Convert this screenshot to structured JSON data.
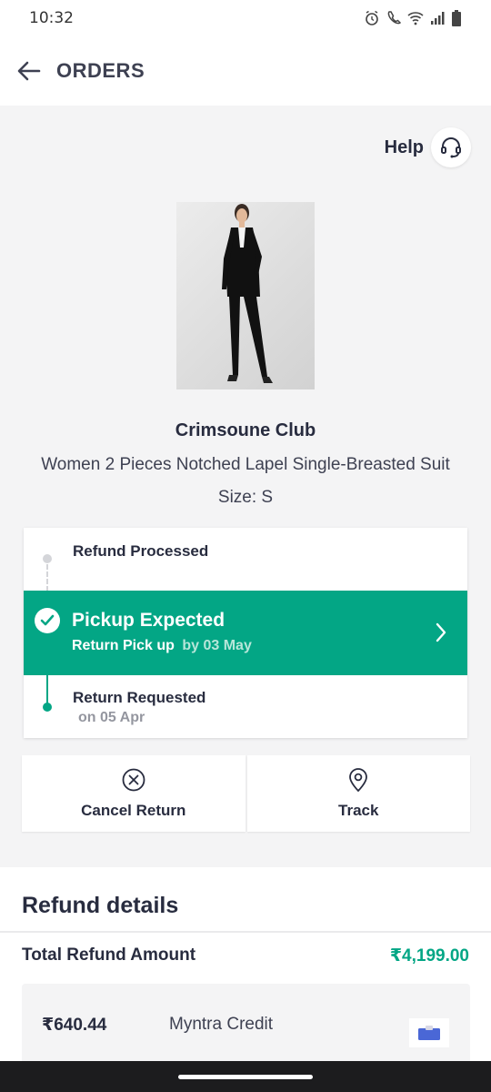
{
  "status_bar": {
    "time": "10:32",
    "icons": [
      "alarm-icon",
      "wifi-calling-icon",
      "wifi-icon",
      "signal-icon",
      "battery-icon"
    ]
  },
  "header": {
    "title": "ORDERS",
    "back_icon": "arrow-left-icon"
  },
  "help": {
    "label": "Help",
    "icon": "headset-icon"
  },
  "product": {
    "brand": "Crimsoune Club",
    "name": "Women 2 Pieces Notched Lapel Single-Breasted Suit",
    "size": "Size: S"
  },
  "tracker": {
    "steps": [
      {
        "label": "Refund Processed",
        "state": "pending"
      },
      {
        "label": "Pickup Expected",
        "sub_label": "Return Pick up",
        "sub_date": "by 03 May",
        "state": "active"
      },
      {
        "label": "Return Requested",
        "date": "on 05 Apr",
        "state": "done"
      }
    ],
    "active_color": "#03a685"
  },
  "actions": [
    {
      "label": "Cancel Return",
      "icon": "close-circle-icon"
    },
    {
      "label": "Track",
      "icon": "location-pin-icon"
    }
  ],
  "refund": {
    "heading": "Refund details",
    "total_label": "Total Refund Amount",
    "total_value": "₹4,199.00",
    "credits": [
      {
        "amount": "₹640.44",
        "method": "Myntra Credit",
        "icon": "wallet-icon"
      }
    ]
  },
  "colors": {
    "accent": "#03a685",
    "text_primary": "#282c3f",
    "background": "#f4f4f5"
  }
}
